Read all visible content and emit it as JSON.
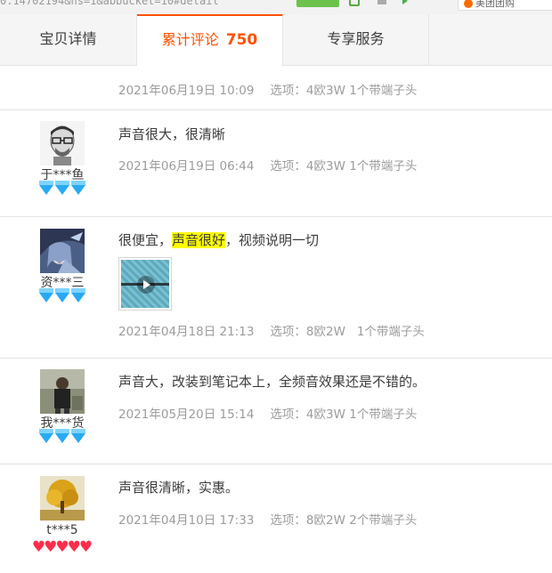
{
  "browser": {
    "url_fragment": "0.14702194&ns=1&abbucket=10#detail",
    "extension_label": "美团团购"
  },
  "tabs": [
    {
      "label": "宝贝详情"
    },
    {
      "label": "累计评论",
      "count": "750"
    },
    {
      "label": "专享服务"
    }
  ],
  "reviews": [
    {
      "partial": true,
      "date": "2021年06月19日 10:09",
      "option": "选项：4欧3W 1个带端子头"
    },
    {
      "nickname": "于***鱼",
      "rank_type": "diamond",
      "rank_count": 3,
      "avatar_icon": "man-with-glasses-avatar",
      "text": "声音很大，很清晰",
      "date": "2021年06月19日 06:44",
      "option": "选项：4欧3W 1个带端子头"
    },
    {
      "nickname": "资***三",
      "rank_type": "diamond",
      "rank_count": 3,
      "avatar_icon": "anime-avatar",
      "text_before": "很便宜，",
      "text_highlight": "声音很好",
      "text_after": "，视频说明一切",
      "has_video": true,
      "date": "2021年04月18日 21:13",
      "option": "选项：8欧2W   1个带端子头"
    },
    {
      "nickname": "我***货",
      "rank_type": "diamond",
      "rank_count": 3,
      "avatar_icon": "person-photo-avatar",
      "text": "声音大，改装到笔记本上，全频音效果还是不错的。",
      "date": "2021年05月20日 15:14",
      "option": "选项：4欧3W 1个带端子头"
    },
    {
      "nickname": "t***5",
      "rank_type": "heart",
      "rank_count": 5,
      "avatar_icon": "autumn-tree-avatar",
      "text": "声音很清晰，实惠。",
      "date": "2021年04月10日 17:33",
      "option": "选项：8欧2W 2个带端子头"
    }
  ],
  "colors": {
    "accent": "#ff5000",
    "diamond": "#2aa9f3",
    "heart": "#ff2d4b",
    "highlight": "#ffff00",
    "meta_text": "#9c9c9c"
  }
}
